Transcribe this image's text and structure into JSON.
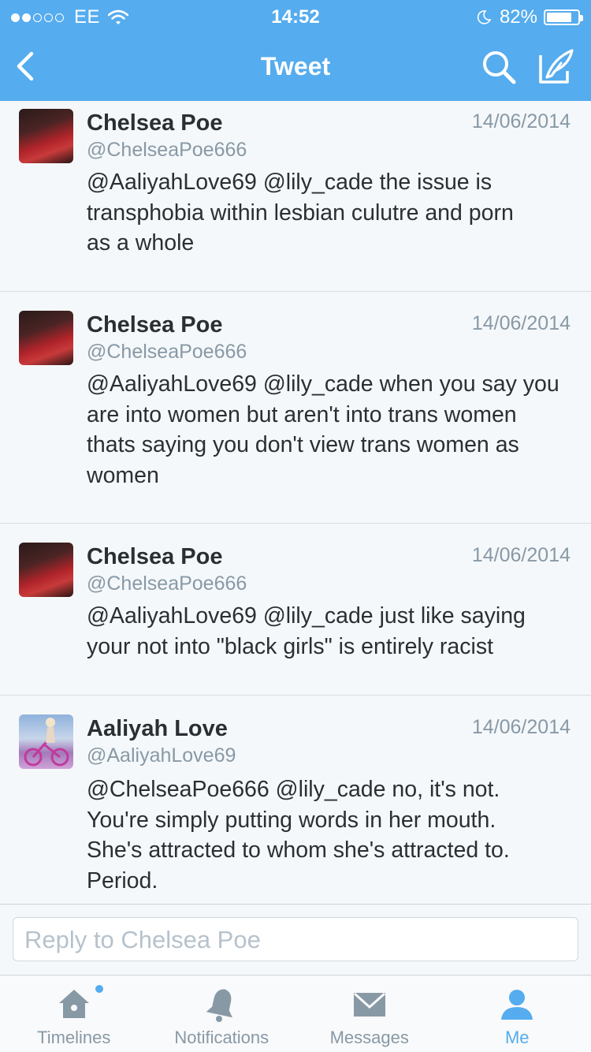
{
  "status_bar": {
    "carrier": "EE",
    "time": "14:52",
    "battery": "82%",
    "battery_level": 0.82
  },
  "nav": {
    "title": "Tweet"
  },
  "tweets": [
    {
      "name": "Chelsea Poe",
      "handle": "@ChelseaPoe666",
      "date": "14/06/2014",
      "lines": [
        "@AaliyahLove69 @lily_cade the issue is",
        "transphobia within lesbian culutre and porn",
        "as a whole"
      ]
    },
    {
      "name": "Chelsea Poe",
      "handle": "@ChelseaPoe666",
      "date": "14/06/2014",
      "lines": [
        "@AaliyahLove69 @lily_cade when you say you",
        "are into women but aren't into trans women",
        "thats saying you don't view trans women as",
        "women"
      ]
    },
    {
      "name": "Chelsea Poe",
      "handle": "@ChelseaPoe666",
      "date": "14/06/2014",
      "lines": [
        "@AaliyahLove69 @lily_cade just like saying",
        "your not into \"black girls\" is entirely racist"
      ]
    },
    {
      "name": "Aaliyah Love",
      "handle": "@AaliyahLove69",
      "date": "14/06/2014",
      "lines": [
        "@ChelseaPoe666 @lily_cade no, it's not.",
        "You're simply putting words in her mouth.",
        "She's attracted to whom she's attracted to.",
        "Period."
      ]
    }
  ],
  "reply": {
    "placeholder": "Reply to Chelsea Poe"
  },
  "tabbar": {
    "items": [
      {
        "label": "Timelines",
        "icon": "home-icon",
        "active": false
      },
      {
        "label": "Notifications",
        "icon": "bell-icon",
        "active": false
      },
      {
        "label": "Messages",
        "icon": "envelope-icon",
        "active": false
      },
      {
        "label": "Me",
        "icon": "person-icon",
        "active": true
      }
    ]
  },
  "colors": {
    "brand": "#55acee",
    "text": "#292f33",
    "muted": "#8899a6"
  }
}
